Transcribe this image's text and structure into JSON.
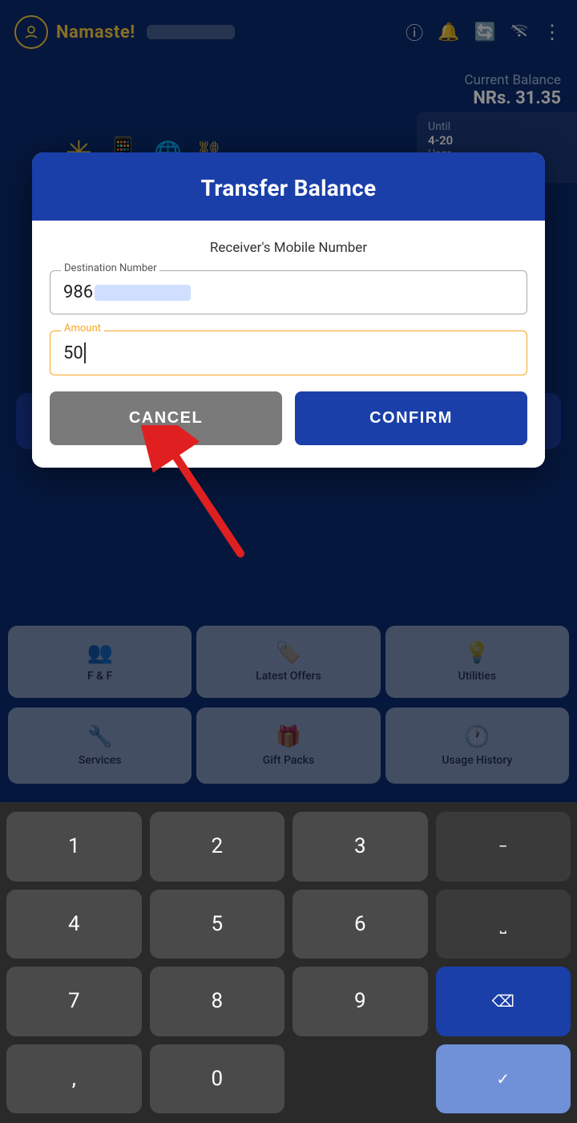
{
  "app": {
    "name": "Namaste!",
    "balance_label": "Current Balance",
    "balance_amount": "NRs. 31.35"
  },
  "header": {
    "title": "Namaste!",
    "icons": [
      "info-icon",
      "bell-icon",
      "refresh-icon",
      "wifi-off-icon",
      "more-icon"
    ]
  },
  "modal": {
    "title": "Transfer Balance",
    "receiver_label": "Receiver's Mobile Number",
    "destination_field_label": "Destination Number",
    "destination_value": "986",
    "amount_field_label": "Amount",
    "amount_value": "50",
    "cancel_button": "CANCEL",
    "confirm_button": "CONFIRM"
  },
  "grid_row1": [
    {
      "label": "F & F",
      "icon": "👥"
    },
    {
      "label": "Latest Offers",
      "icon": "🏷️"
    },
    {
      "label": "Utilities",
      "icon": "💡"
    }
  ],
  "grid_row2": [
    {
      "label": "Services",
      "icon": "🔧"
    },
    {
      "label": "Gift Packs",
      "icon": "🎁"
    },
    {
      "label": "Usage History",
      "icon": "🕐"
    }
  ],
  "keyboard": {
    "rows": [
      [
        "1",
        "2",
        "3",
        "−"
      ],
      [
        "4",
        "5",
        "6",
        "⎵"
      ],
      [
        "7",
        "8",
        "9",
        "⌫"
      ],
      [
        ",",
        "0",
        "",
        "✓"
      ]
    ]
  }
}
